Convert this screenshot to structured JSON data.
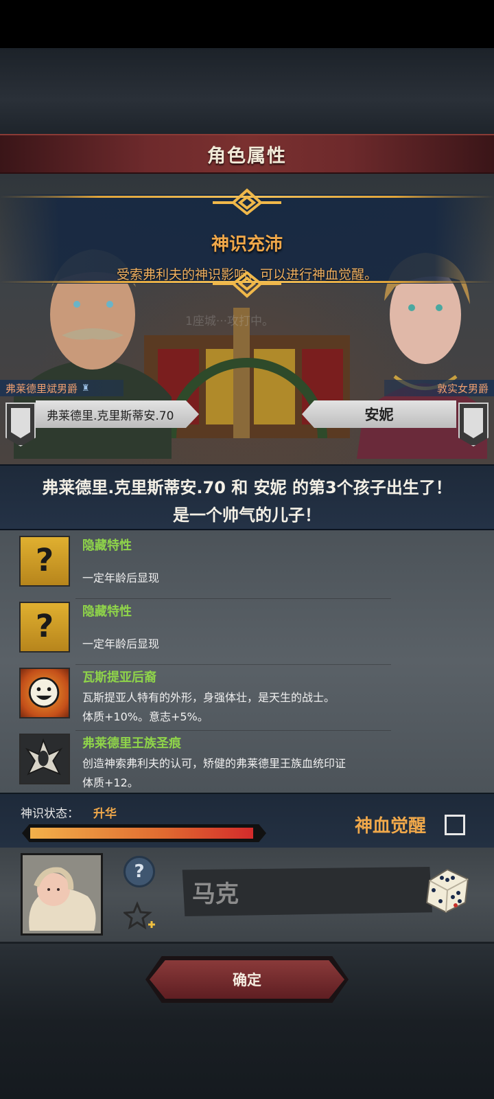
{
  "header": {
    "title": "角色属性"
  },
  "notice": {
    "title": "神识充沛",
    "text": "受索弗利夫的神识影响，可以进行神血觉醒。",
    "background_text": "1座城···攻打中。"
  },
  "parents": {
    "father": {
      "rank": "弗莱德里斌男爵",
      "name": "弗莱德里.克里斯蒂安.70"
    },
    "mother": {
      "rank": "敦实女男爵",
      "name": "安妮"
    }
  },
  "birth": {
    "line1": "弗莱德里.克里斯蒂安.70 和 安妮 的第3个孩子出生了！",
    "line2": "是一个帅气的儿子！"
  },
  "traits": [
    {
      "name": "隐藏特性",
      "desc": [
        "一定年龄后显现"
      ],
      "icon": "question-mark-icon"
    },
    {
      "name": "隐藏特性",
      "desc": [
        "一定年龄后显现"
      ],
      "icon": "question-mark-icon"
    },
    {
      "name": "瓦斯提亚后裔",
      "desc": [
        "瓦斯提亚人特有的外形，身强体壮，是天生的战士。",
        "体质+10%。意志+5%。"
      ],
      "icon": "smiling-sun-icon"
    },
    {
      "name": "弗莱德里王族圣痕",
      "desc": [
        "创造神索弗利夫的认可，矫健的弗莱德里王族血统印证",
        "体质+12。"
      ],
      "icon": "royal-stigma-icon"
    }
  ],
  "status": {
    "label": "神识状态：",
    "value": "升华",
    "progress": 0.98,
    "awaken_label": "神血觉醒",
    "awaken_checked": false
  },
  "child": {
    "name": "马克"
  },
  "confirm_label": "确定",
  "colors": {
    "accent_gold": "#f0a84a",
    "trait_green": "#8fd44a",
    "title_red": "#6e2a2c",
    "panel_navy": "#1e2a3a"
  }
}
